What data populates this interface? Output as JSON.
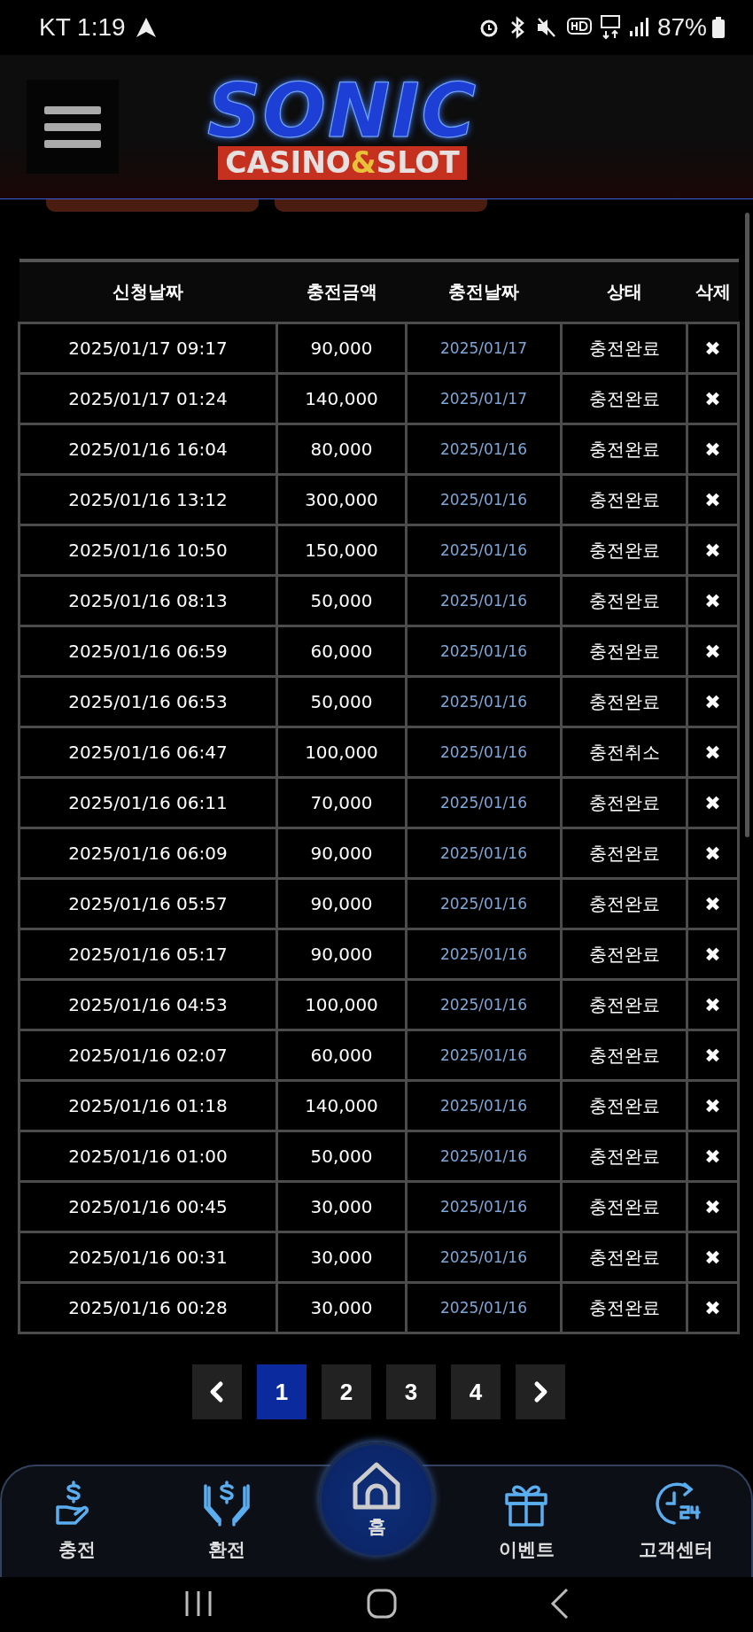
{
  "status_bar": {
    "carrier_time": "KT 1:19",
    "battery": "87%"
  },
  "header": {
    "logo": {
      "title": "SONIC",
      "subtitle": [
        "CASINO",
        "&",
        "SLOT"
      ]
    }
  },
  "table": {
    "columns": [
      "신청날짜",
      "충전금액",
      "충전날짜",
      "상태",
      "삭제"
    ],
    "rows": [
      {
        "requested": "2025/01/17 09:17",
        "amount": "90,000",
        "charged": "2025/01/17",
        "status": "충전완료",
        "delete": "✖"
      },
      {
        "requested": "2025/01/17 01:24",
        "amount": "140,000",
        "charged": "2025/01/17",
        "status": "충전완료",
        "delete": "✖"
      },
      {
        "requested": "2025/01/16 16:04",
        "amount": "80,000",
        "charged": "2025/01/16",
        "status": "충전완료",
        "delete": "✖"
      },
      {
        "requested": "2025/01/16 13:12",
        "amount": "300,000",
        "charged": "2025/01/16",
        "status": "충전완료",
        "delete": "✖"
      },
      {
        "requested": "2025/01/16 10:50",
        "amount": "150,000",
        "charged": "2025/01/16",
        "status": "충전완료",
        "delete": "✖"
      },
      {
        "requested": "2025/01/16 08:13",
        "amount": "50,000",
        "charged": "2025/01/16",
        "status": "충전완료",
        "delete": "✖"
      },
      {
        "requested": "2025/01/16 06:59",
        "amount": "60,000",
        "charged": "2025/01/16",
        "status": "충전완료",
        "delete": "✖"
      },
      {
        "requested": "2025/01/16 06:53",
        "amount": "50,000",
        "charged": "2025/01/16",
        "status": "충전완료",
        "delete": "✖"
      },
      {
        "requested": "2025/01/16 06:47",
        "amount": "100,000",
        "charged": "2025/01/16",
        "status": "충전취소",
        "delete": "✖"
      },
      {
        "requested": "2025/01/16 06:11",
        "amount": "70,000",
        "charged": "2025/01/16",
        "status": "충전완료",
        "delete": "✖"
      },
      {
        "requested": "2025/01/16 06:09",
        "amount": "90,000",
        "charged": "2025/01/16",
        "status": "충전완료",
        "delete": "✖"
      },
      {
        "requested": "2025/01/16 05:57",
        "amount": "90,000",
        "charged": "2025/01/16",
        "status": "충전완료",
        "delete": "✖"
      },
      {
        "requested": "2025/01/16 05:17",
        "amount": "90,000",
        "charged": "2025/01/16",
        "status": "충전완료",
        "delete": "✖"
      },
      {
        "requested": "2025/01/16 04:53",
        "amount": "100,000",
        "charged": "2025/01/16",
        "status": "충전완료",
        "delete": "✖"
      },
      {
        "requested": "2025/01/16 02:07",
        "amount": "60,000",
        "charged": "2025/01/16",
        "status": "충전완료",
        "delete": "✖"
      },
      {
        "requested": "2025/01/16 01:18",
        "amount": "140,000",
        "charged": "2025/01/16",
        "status": "충전완료",
        "delete": "✖"
      },
      {
        "requested": "2025/01/16 01:00",
        "amount": "50,000",
        "charged": "2025/01/16",
        "status": "충전완료",
        "delete": "✖"
      },
      {
        "requested": "2025/01/16 00:45",
        "amount": "30,000",
        "charged": "2025/01/16",
        "status": "충전완료",
        "delete": "✖"
      },
      {
        "requested": "2025/01/16 00:31",
        "amount": "30,000",
        "charged": "2025/01/16",
        "status": "충전완료",
        "delete": "✖"
      },
      {
        "requested": "2025/01/16 00:28",
        "amount": "30,000",
        "charged": "2025/01/16",
        "status": "충전완료",
        "delete": "✖"
      }
    ]
  },
  "pagination": {
    "pages": [
      {
        "label": "1",
        "selected": true
      },
      {
        "label": "2",
        "selected": false
      },
      {
        "label": "3",
        "selected": false
      },
      {
        "label": "4",
        "selected": false
      }
    ]
  },
  "bottom_nav": [
    {
      "kind": "charge",
      "label": "충전"
    },
    {
      "kind": "exchange",
      "label": "환전"
    },
    {
      "kind": "home",
      "label": "홈"
    },
    {
      "kind": "event",
      "label": "이벤트"
    },
    {
      "kind": "support",
      "label": "고객센터"
    }
  ]
}
